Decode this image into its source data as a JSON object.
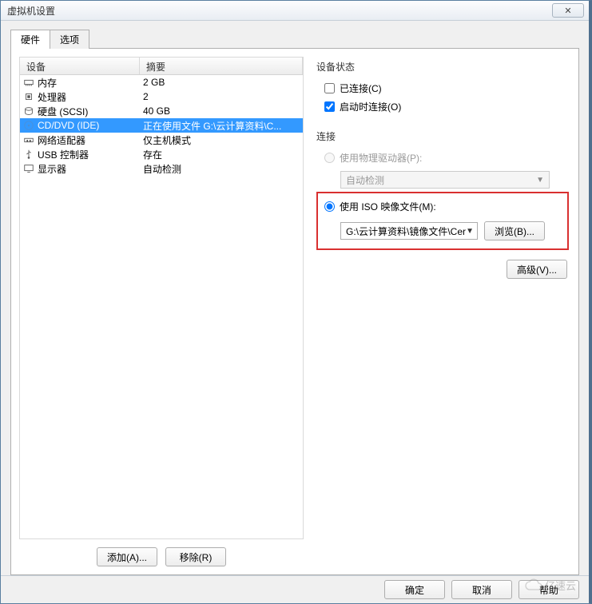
{
  "window": {
    "title": "虚拟机设置",
    "close_glyph": "✕"
  },
  "tabs": {
    "hardware": "硬件",
    "options": "选项"
  },
  "table": {
    "headers": {
      "device": "设备",
      "summary": "摘要"
    },
    "rows": [
      {
        "icon": "memory",
        "device": "内存",
        "summary": "2 GB"
      },
      {
        "icon": "cpu",
        "device": "处理器",
        "summary": "2"
      },
      {
        "icon": "disk",
        "device": "硬盘 (SCSI)",
        "summary": "40 GB"
      },
      {
        "icon": "cd",
        "device": "CD/DVD (IDE)",
        "summary": "正在使用文件 G:\\云计算资料\\C..."
      },
      {
        "icon": "nic",
        "device": "网络适配器",
        "summary": "仅主机模式"
      },
      {
        "icon": "usb",
        "device": "USB 控制器",
        "summary": "存在"
      },
      {
        "icon": "display",
        "device": "显示器",
        "summary": "自动检测"
      }
    ]
  },
  "status": {
    "title": "设备状态",
    "connected": "已连接(C)",
    "connect_at_power": "启动时连接(O)"
  },
  "connection": {
    "title": "连接",
    "physical_label": "使用物理驱动器(P):",
    "autodetect": "自动检测",
    "iso_label": "使用 ISO 映像文件(M):",
    "iso_value": "G:\\云计算资料\\镜像文件\\Cer",
    "browse": "浏览(B)..."
  },
  "buttons": {
    "add": "添加(A)...",
    "remove": "移除(R)",
    "advanced": "高级(V)...",
    "ok": "确定",
    "cancel": "取消",
    "help": "帮助"
  },
  "watermark": "亿速云"
}
